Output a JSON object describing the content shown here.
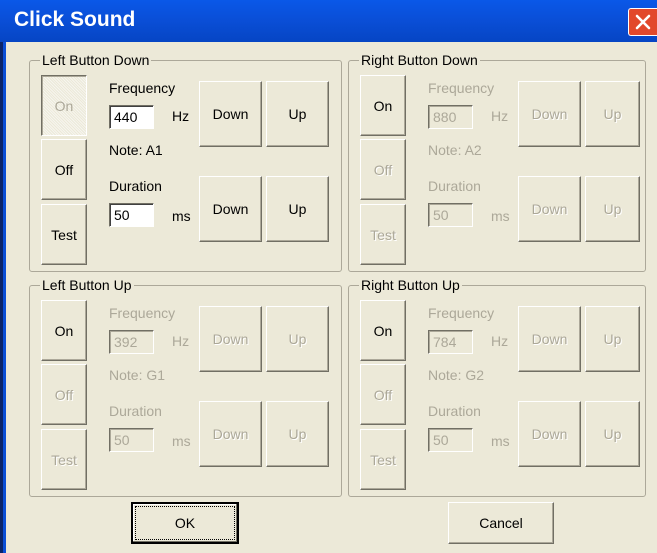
{
  "window": {
    "title": "Click Sound"
  },
  "groups": {
    "left_down": {
      "label": "Left Button Down",
      "on": "On",
      "off": "Off",
      "test": "Test",
      "freq_label": "Frequency",
      "freq_value": "440",
      "freq_unit": "Hz",
      "note": "Note: A1",
      "dur_label": "Duration",
      "dur_value": "50",
      "dur_unit": "ms",
      "down": "Down",
      "up": "Up"
    },
    "right_down": {
      "label": "Right Button Down",
      "on": "On",
      "off": "Off",
      "test": "Test",
      "freq_label": "Frequency",
      "freq_value": "880",
      "freq_unit": "Hz",
      "note": "Note: A2",
      "dur_label": "Duration",
      "dur_value": "50",
      "dur_unit": "ms",
      "down": "Down",
      "up": "Up"
    },
    "left_up": {
      "label": "Left Button Up",
      "on": "On",
      "off": "Off",
      "test": "Test",
      "freq_label": "Frequency",
      "freq_value": "392",
      "freq_unit": "Hz",
      "note": "Note: G1",
      "dur_label": "Duration",
      "dur_value": "50",
      "dur_unit": "ms",
      "down": "Down",
      "up": "Up"
    },
    "right_up": {
      "label": "Right Button Up",
      "on": "On",
      "off": "Off",
      "test": "Test",
      "freq_label": "Frequency",
      "freq_value": "784",
      "freq_unit": "Hz",
      "note": "Note: G2",
      "dur_label": "Duration",
      "dur_value": "50",
      "dur_unit": "ms",
      "down": "Down",
      "up": "Up"
    }
  },
  "footer": {
    "ok": "OK",
    "cancel": "Cancel"
  },
  "icons": {
    "close": "close-icon"
  },
  "colors": {
    "titlebar": "#0a4fd8",
    "face": "#ece9d8",
    "disabled_text": "#aca899",
    "close": "#e2482b"
  }
}
